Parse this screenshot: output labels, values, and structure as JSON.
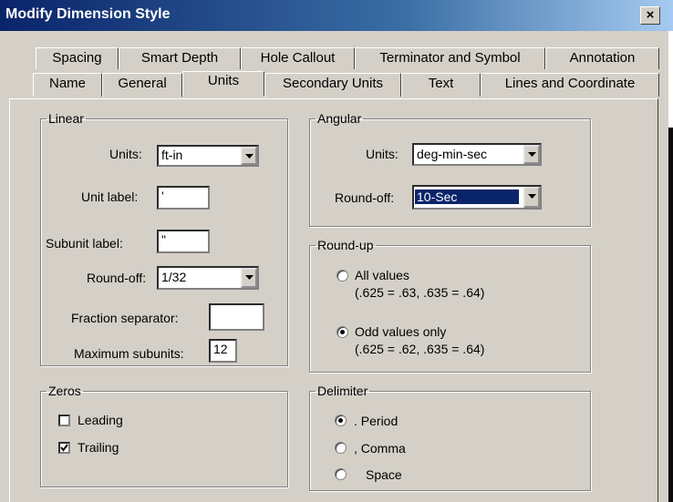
{
  "window": {
    "title": "Modify Dimension Style",
    "close_glyph": "×"
  },
  "tabs": {
    "row1": [
      "Spacing",
      "Smart Depth",
      "Hole Callout",
      "Terminator and Symbol",
      "Annotation"
    ],
    "row2": [
      "Name",
      "General",
      "Units",
      "Secondary Units",
      "Text",
      "Lines and Coordinate"
    ],
    "active": "Units"
  },
  "linear": {
    "title": "Linear",
    "units_label": "Units:",
    "units_value": "ft-in",
    "unit_label_label": "Unit label:",
    "unit_label_value": "'",
    "subunit_label_label": "Subunit label:",
    "subunit_label_value": "\"",
    "roundoff_label": "Round-off:",
    "roundoff_value": "1/32",
    "fraction_sep_label": "Fraction separator:",
    "fraction_sep_value": "",
    "max_subunits_label": "Maximum subunits:",
    "max_subunits_value": "12"
  },
  "angular": {
    "title": "Angular",
    "units_label": "Units:",
    "units_value": "deg-min-sec",
    "roundoff_label": "Round-off:",
    "roundoff_value": "10-Sec"
  },
  "roundup": {
    "title": "Round-up",
    "options": [
      {
        "label": "All values",
        "example": "(.625 = .63, .635 = .64)",
        "selected": false
      },
      {
        "label": "Odd values only",
        "example": "(.625 = .62, .635 = .64)",
        "selected": true
      }
    ]
  },
  "zeros": {
    "title": "Zeros",
    "leading_label": "Leading",
    "leading_checked": false,
    "trailing_label": "Trailing",
    "trailing_checked": true
  },
  "delimiter": {
    "title": "Delimiter",
    "options": [
      {
        "label": ". Period",
        "selected": true
      },
      {
        "label": ", Comma",
        "selected": false
      },
      {
        "label": "Space",
        "selected": false
      }
    ]
  },
  "colors": {
    "title_bar_start": "#0a246a",
    "dialog_face": "#d4d0c8",
    "selection": "#0a246a"
  }
}
